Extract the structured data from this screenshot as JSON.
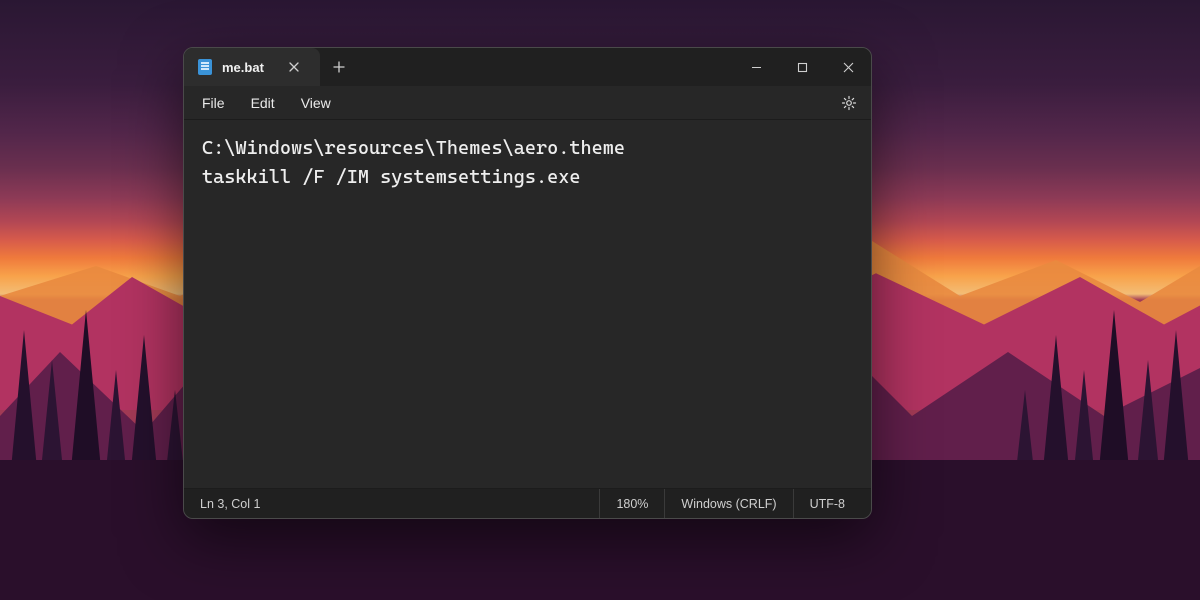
{
  "tab": {
    "title": "me.bat",
    "close_glyph": "✕",
    "new_glyph": "＋"
  },
  "menu": {
    "file": "File",
    "edit": "Edit",
    "view": "View"
  },
  "editor": {
    "line1": "C:\\Windows\\resources\\Themes\\aero.theme",
    "line2": "taskkill /F /IM systemsettings.exe"
  },
  "status": {
    "cursor": "Ln 3, Col 1",
    "zoom": "180%",
    "eol": "Windows (CRLF)",
    "encoding": "UTF-8"
  },
  "window_controls": {
    "minimize": "—",
    "maximize": "▢",
    "close": "✕"
  }
}
